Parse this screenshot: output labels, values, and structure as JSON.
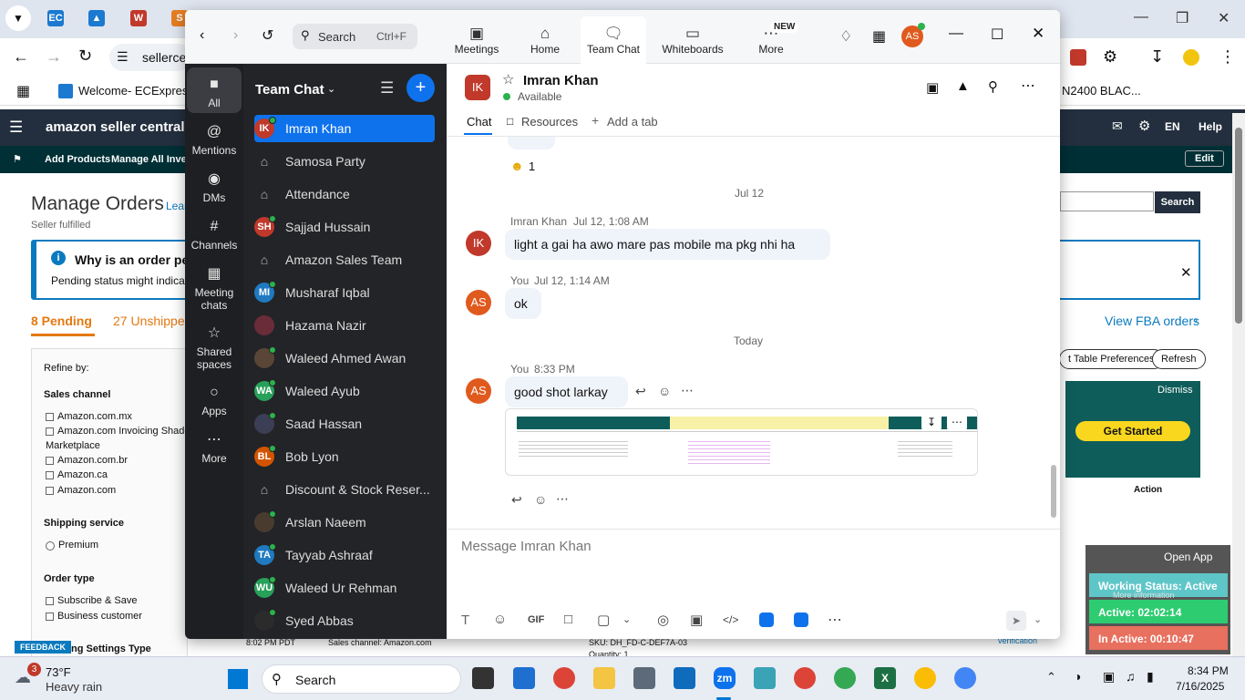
{
  "browser": {
    "address": "sellerce",
    "bookmark": "Welcome- ECExpres...",
    "bookmark_right": "N2400 BLAC..."
  },
  "amazon": {
    "logo": "amazon seller central",
    "lang": "EN",
    "help": "Help",
    "nav": [
      "Add Products",
      "Manage All Invent"
    ],
    "edit": "Edit",
    "page_title": "Manage Orders",
    "learn": "Lear",
    "subtitle": "Seller fulfilled",
    "banner_title": "Why is an order pen",
    "banner_text": "Pending status might indicate",
    "search_btn": "Search",
    "tab_pending": "8 Pending",
    "tab_unshipped": "27 Unshippe",
    "view_fba": "View FBA orders",
    "refine": "Refine by:",
    "sales_channel": "Sales channel",
    "channels": [
      "Amazon.com.mx",
      "Amazon.com Invoicing Shado",
      "Marketplace",
      "Amazon.com.br",
      "Amazon.ca",
      "Amazon.com"
    ],
    "shipping_service": "Shipping service",
    "premium": "Premium",
    "order_type": "Order type",
    "order_types": [
      "Subscribe & Save",
      "Business customer"
    ],
    "settings_type": "ng Settings Type",
    "feedback": "FEEDBACK",
    "table_prefs": "t Table Preferences",
    "refresh": "Refresh",
    "dismiss": "Dismiss",
    "get_started": "Get Started",
    "action": "Action",
    "order_time": "8:02 PM PDT",
    "sales_channel_val": "Sales channel: Amazon.com",
    "sku": "SKU: DH_FD-C-DEF7A-03",
    "quantity": "Quantity: 1",
    "verification": "verification"
  },
  "widget": {
    "open_app": "Open App",
    "working": "Working Status: Active",
    "more_info": "More information",
    "active": "Active: 02:02:14",
    "inactive": "In Active: 00:10:47"
  },
  "zoom": {
    "search_label": "Search",
    "search_shortcut": "Ctrl+F",
    "nav": {
      "meetings": "Meetings",
      "home": "Home",
      "team_chat": "Team Chat",
      "whiteboards": "Whiteboards",
      "more": "More",
      "new_badge": "NEW"
    },
    "user_initials": "AS",
    "rail": [
      {
        "label": "All",
        "icon": "chat-bubble-icon"
      },
      {
        "label": "Mentions",
        "icon": "at-icon"
      },
      {
        "label": "DMs",
        "icon": "people-icon"
      },
      {
        "label": "Channels",
        "icon": "hash-icon"
      },
      {
        "label": "Meeting chats",
        "icon": "calendar-icon"
      },
      {
        "label": "Shared spaces",
        "icon": "share-icon"
      },
      {
        "label": "Apps",
        "icon": "apps-icon"
      },
      {
        "label": "More",
        "icon": "ellipsis-icon"
      }
    ],
    "list_title": "Team Chat",
    "chats": [
      {
        "name": "Imran Khan",
        "initials": "IK",
        "color": "#c0392b",
        "type": "user",
        "online": true
      },
      {
        "name": "Samosa Party",
        "type": "lock"
      },
      {
        "name": "Attendance",
        "type": "lock"
      },
      {
        "name": "Sajjad Hussain",
        "initials": "SH",
        "color": "#c0392b",
        "type": "user",
        "online": true
      },
      {
        "name": "Amazon Sales Team",
        "type": "lock"
      },
      {
        "name": "Musharaf Iqbal",
        "initials": "MI",
        "color": "#1f7ac0",
        "type": "user",
        "online": true
      },
      {
        "name": "Hazama Nazir",
        "initials": "",
        "color": "#6b2c3a",
        "type": "user",
        "online": false
      },
      {
        "name": "Waleed Ahmed Awan",
        "initials": "",
        "color": "#5a4636",
        "type": "user",
        "online": true
      },
      {
        "name": "Waleed Ayub",
        "initials": "WA",
        "color": "#27a05a",
        "type": "user",
        "online": true
      },
      {
        "name": "Saad Hassan",
        "initials": "",
        "color": "#3b3f55",
        "type": "user",
        "online": true
      },
      {
        "name": "Bob Lyon",
        "initials": "BL",
        "color": "#d35400",
        "type": "user",
        "online": true
      },
      {
        "name": "Discount & Stock Reser...",
        "type": "lock"
      },
      {
        "name": "Arslan Naeem",
        "initials": "",
        "color": "#4a3b2f",
        "type": "user",
        "online": true
      },
      {
        "name": "Tayyab Ashraaf",
        "initials": "TA",
        "color": "#1f7ac0",
        "type": "user",
        "online": true
      },
      {
        "name": "Waleed Ur Rehman",
        "initials": "WU",
        "color": "#27a05a",
        "type": "user",
        "online": true
      },
      {
        "name": "Syed Abbas",
        "initials": "",
        "color": "#2b2b2b",
        "type": "user",
        "online": true
      }
    ],
    "header": {
      "name": "Imran Khan",
      "initials": "IK",
      "status": "Available"
    },
    "tabs": {
      "chat": "Chat",
      "resources": "Resources",
      "add_tab": "Add a tab"
    },
    "reaction_count": "1",
    "date1": "Jul 12",
    "msg1": {
      "sender": "Imran Khan",
      "time": "Jul 12, 1:08 AM",
      "text": "light a gai ha awo mare pas mobile ma pkg nhi ha",
      "initials": "IK"
    },
    "msg2": {
      "sender": "You",
      "time": "Jul 12, 1:14 AM",
      "text": "ok",
      "initials": "AS"
    },
    "date2": "Today",
    "msg3": {
      "sender": "You",
      "time": "8:33 PM",
      "text": "good shot larkay",
      "initials": "AS"
    },
    "compose_placeholder": "Message Imran Khan"
  },
  "taskbar": {
    "weather_badge": "3",
    "temp": "73°F",
    "weather": "Heavy rain",
    "search": "Search",
    "time": "8:34 PM",
    "date": "7/16/2025"
  }
}
